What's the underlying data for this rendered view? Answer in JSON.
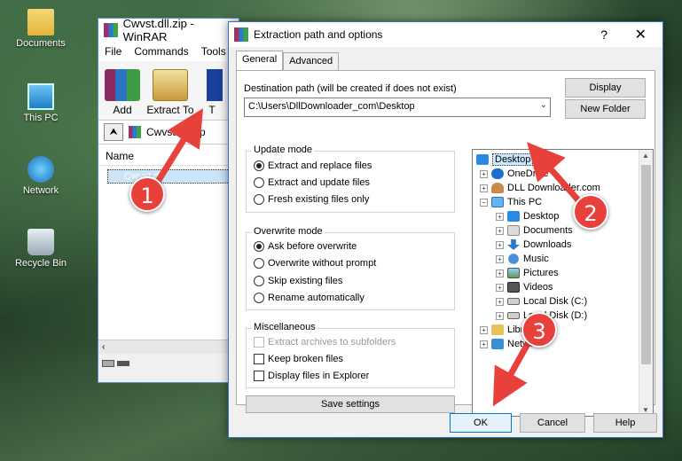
{
  "desktop": {
    "icons": [
      {
        "label": "Documents",
        "icon": "folder-icon"
      },
      {
        "label": "This PC",
        "icon": "computer-icon"
      },
      {
        "label": "Network",
        "icon": "network-icon"
      },
      {
        "label": "Recycle Bin",
        "icon": "recycle-bin-icon"
      }
    ]
  },
  "winrar": {
    "title": "Cwvst.dll.zip - WinRAR",
    "menu": [
      "File",
      "Commands",
      "Tools"
    ],
    "toolbar": {
      "add": "Add",
      "extract_to": "Extract To",
      "third": "T"
    },
    "path": "Cwvst.dll.zip",
    "list_header": "Name",
    "file": "Cwvst.dll"
  },
  "dialog": {
    "title": "Extraction path and options",
    "help": "?",
    "close": "✕",
    "tabs": [
      "General",
      "Advanced"
    ],
    "dest_label": "Destination path (will be created if does not exist)",
    "dest_value": "C:\\Users\\DllDownloader_com\\Desktop",
    "display_btn": "Display",
    "new_folder_btn": "New Folder",
    "update_mode": {
      "title": "Update mode",
      "options": [
        "Extract and replace files",
        "Extract and update files",
        "Fresh existing files only"
      ],
      "selected": 0
    },
    "overwrite_mode": {
      "title": "Overwrite mode",
      "options": [
        "Ask before overwrite",
        "Overwrite without prompt",
        "Skip existing files",
        "Rename automatically"
      ],
      "selected": 0
    },
    "misc": {
      "title": "Miscellaneous",
      "options": [
        "Extract archives to subfolders",
        "Keep broken files",
        "Display files in Explorer"
      ]
    },
    "save_settings": "Save settings",
    "tree": [
      {
        "label": "Desktop",
        "icon": "blue",
        "selected": true
      },
      {
        "label": "OneDrive",
        "icon": "cloud"
      },
      {
        "label": "DLL Downloader.com",
        "icon": "user"
      },
      {
        "label": "This PC",
        "icon": "pc"
      },
      {
        "label": "Desktop",
        "icon": "blue"
      },
      {
        "label": "Documents",
        "icon": "docs"
      },
      {
        "label": "Downloads",
        "icon": "dl"
      },
      {
        "label": "Music",
        "icon": "music"
      },
      {
        "label": "Pictures",
        "icon": "pics"
      },
      {
        "label": "Videos",
        "icon": "vid"
      },
      {
        "label": "Local Disk (C:)",
        "icon": "disk"
      },
      {
        "label": "Local Disk (D:)",
        "icon": "disk"
      },
      {
        "label": "Libraries",
        "icon": "lib"
      },
      {
        "label": "Network",
        "icon": "net"
      }
    ],
    "buttons": {
      "ok": "OK",
      "cancel": "Cancel",
      "help": "Help"
    }
  },
  "annotations": [
    "1",
    "2",
    "3"
  ],
  "colors": {
    "badge": "#e8403a",
    "selection": "#cce8ff",
    "accent": "#0078d7"
  }
}
